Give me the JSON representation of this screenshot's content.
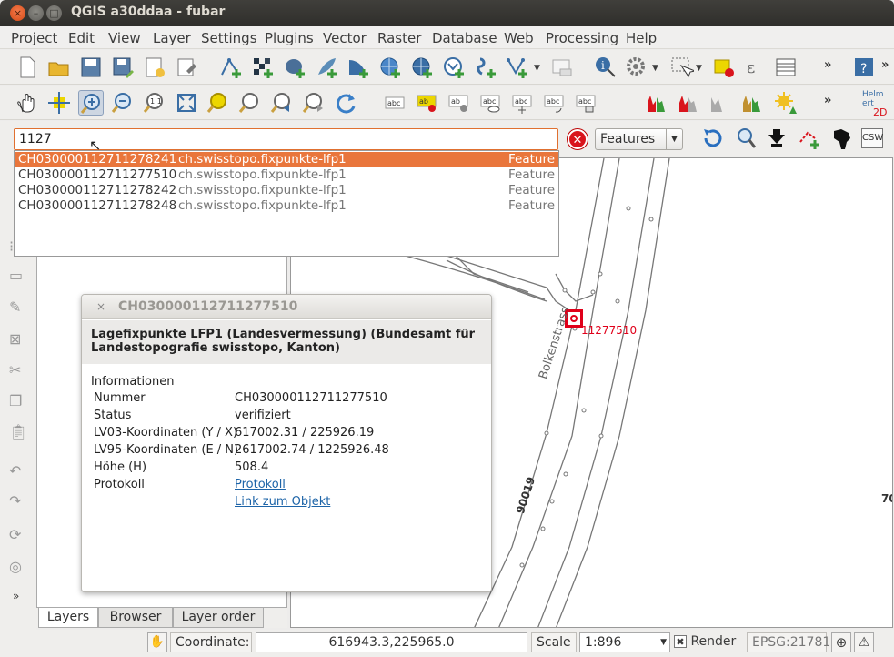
{
  "window": {
    "title": "QGIS a30ddaa - fubar"
  },
  "menu": [
    "Project",
    "Edit",
    "View",
    "Layer",
    "Settings",
    "Plugins",
    "Vector",
    "Raster",
    "Database",
    "Web",
    "Processing",
    "Help"
  ],
  "toolbar": {
    "overflow": "»",
    "helmert_label": "Helm ert",
    "helmert_2d": "2D",
    "csw_label": "CSW"
  },
  "search": {
    "value": "1127",
    "clear_label": "✕",
    "mode": "Features",
    "results": [
      {
        "id": "CH030000112711278241",
        "layer": "ch.swisstopo.fixpunkte-lfp1",
        "type": "Feature"
      },
      {
        "id": "CH030000112711277510",
        "layer": "ch.swisstopo.fixpunkte-lfp1",
        "type": "Feature"
      },
      {
        "id": "CH030000112711278242",
        "layer": "ch.swisstopo.fixpunkte-lfp1",
        "type": "Feature"
      },
      {
        "id": "CH030000112711278248",
        "layer": "ch.swisstopo.fixpunkte-lfp1",
        "type": "Feature"
      }
    ]
  },
  "popup": {
    "close": "×",
    "title": "CH030000112711277510",
    "subtitle": "Lagefixpunkte LFP1 (Landesvermessung) (Bundesamt für Landestopografie swisstopo, Kanton)",
    "section": "Informationen",
    "rows": [
      {
        "key": "Nummer",
        "value": "CH030000112711277510"
      },
      {
        "key": "Status",
        "value": "verifiziert"
      },
      {
        "key": "LV03-Koordinaten (Y / X)",
        "value": "617002.31 / 225926.19"
      },
      {
        "key": "LV95-Koordinaten (E / N)",
        "value": "2617002.74 / 1225926.48"
      },
      {
        "key": "Höhe (H)",
        "value": "508.4"
      },
      {
        "key": "Protokoll",
        "value": "Protokoll"
      }
    ],
    "object_link": "Link zum Objekt"
  },
  "map": {
    "point_label": "11277510",
    "street_label": "Bolkenstrass",
    "road_number": "90019",
    "edge_label": "70"
  },
  "tabs": [
    "Layers",
    "Browser",
    "Layer order"
  ],
  "status": {
    "coordinate_label": "Coordinate:",
    "coordinate_value": "616943.3,225965.0",
    "scale_label": "Scale",
    "scale_value": "1:896",
    "render_label": "Render",
    "render_check": "✖",
    "crs": "EPSG:21781"
  },
  "colors": {
    "accent": "#e9763c",
    "marker": "#e0001a",
    "link": "#1d64a8"
  }
}
